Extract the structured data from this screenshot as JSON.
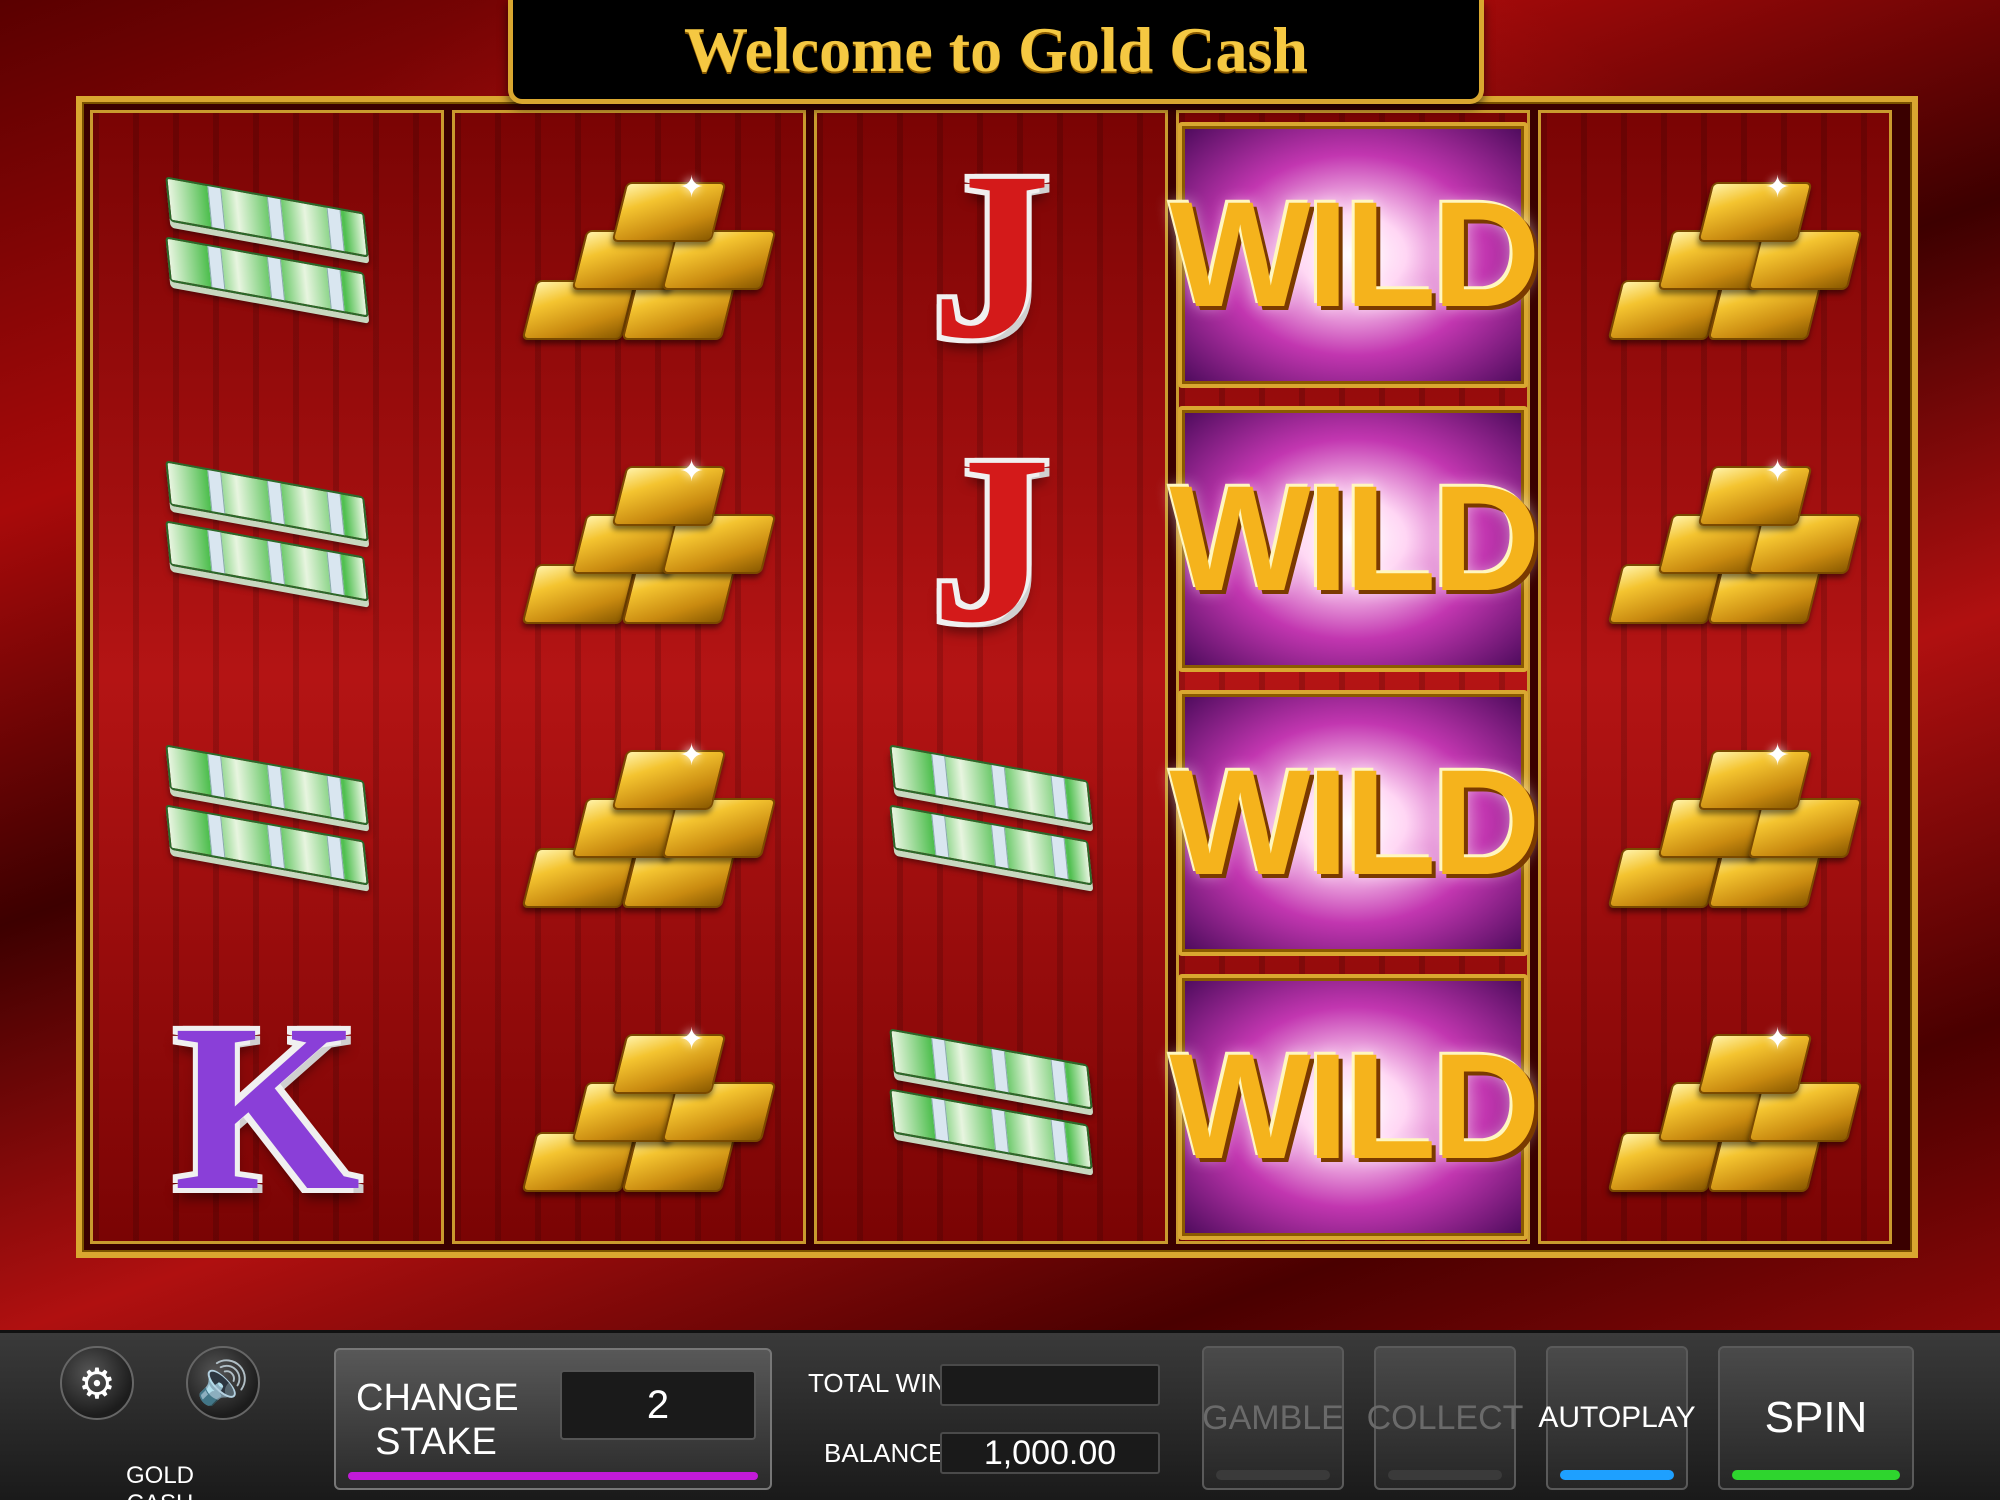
{
  "title": "Welcome to Gold Cash",
  "reels": [
    [
      "cash",
      "cash",
      "cash",
      "K"
    ],
    [
      "gold",
      "gold",
      "gold",
      "gold"
    ],
    [
      "J",
      "J",
      "cash",
      "cash"
    ],
    [
      "WILD",
      "WILD",
      "WILD",
      "WILD"
    ],
    [
      "gold",
      "gold",
      "gold",
      "gold"
    ]
  ],
  "symbols": {
    "wild_label": "WILD",
    "j_label": "J",
    "k_label": "K"
  },
  "controls": {
    "settings_icon": "gear-icon",
    "sound_icon": "speaker-icon",
    "brand": "GOLD CASH",
    "change_stake_line1": "CHANGE",
    "change_stake_line2": "STAKE",
    "stake_value": "2",
    "total_win_label": "TOTAL WIN",
    "total_win_value": "",
    "balance_label": "BALANCE",
    "balance_value": "1,000.00",
    "gamble_label": "GAMBLE",
    "collect_label": "COLLECT",
    "autoplay_label": "AUTOPLAY",
    "spin_label": "SPIN"
  },
  "colors": {
    "gold_border": "#d9a730",
    "stake_accent": "#c21ad8",
    "autoplay_accent": "#1ea0ff",
    "spin_accent": "#2ed52e"
  }
}
